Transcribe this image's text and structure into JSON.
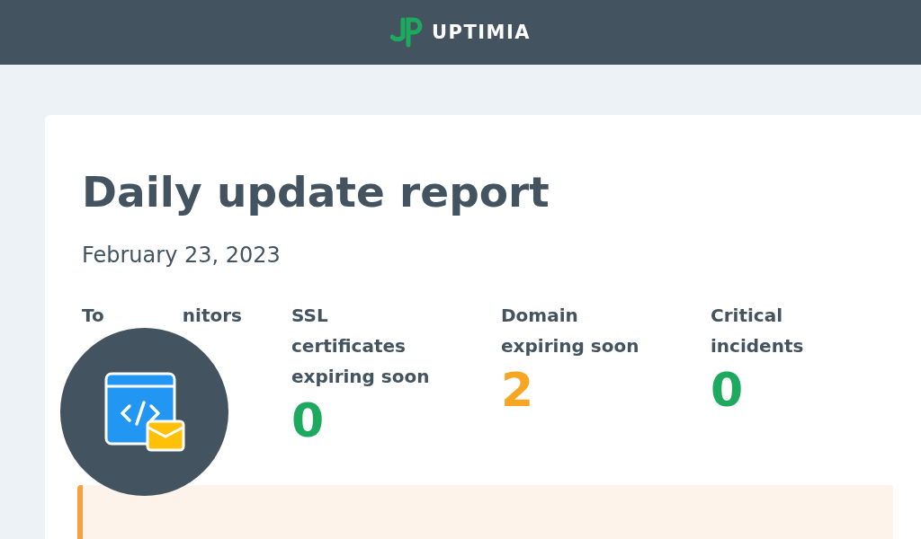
{
  "header": {
    "brand": "UPTIMIA"
  },
  "report": {
    "title": "Daily update report",
    "date": "February 23, 2023",
    "stats": [
      {
        "kind": "covered",
        "label_start": "To",
        "label_end": "nitors"
      },
      {
        "kind": "plain",
        "label": "SSL certificates expiring soon",
        "value": "0",
        "color": "#1daa5f"
      },
      {
        "kind": "plain",
        "label": "Domain expiring soon",
        "value": "2",
        "color": "#f6a623"
      },
      {
        "kind": "plain",
        "label": "Critical incidents",
        "value": "0",
        "color": "#1daa5f"
      }
    ],
    "badge": {
      "kind": "email-code"
    },
    "alert": {
      "kind": "warning"
    }
  }
}
